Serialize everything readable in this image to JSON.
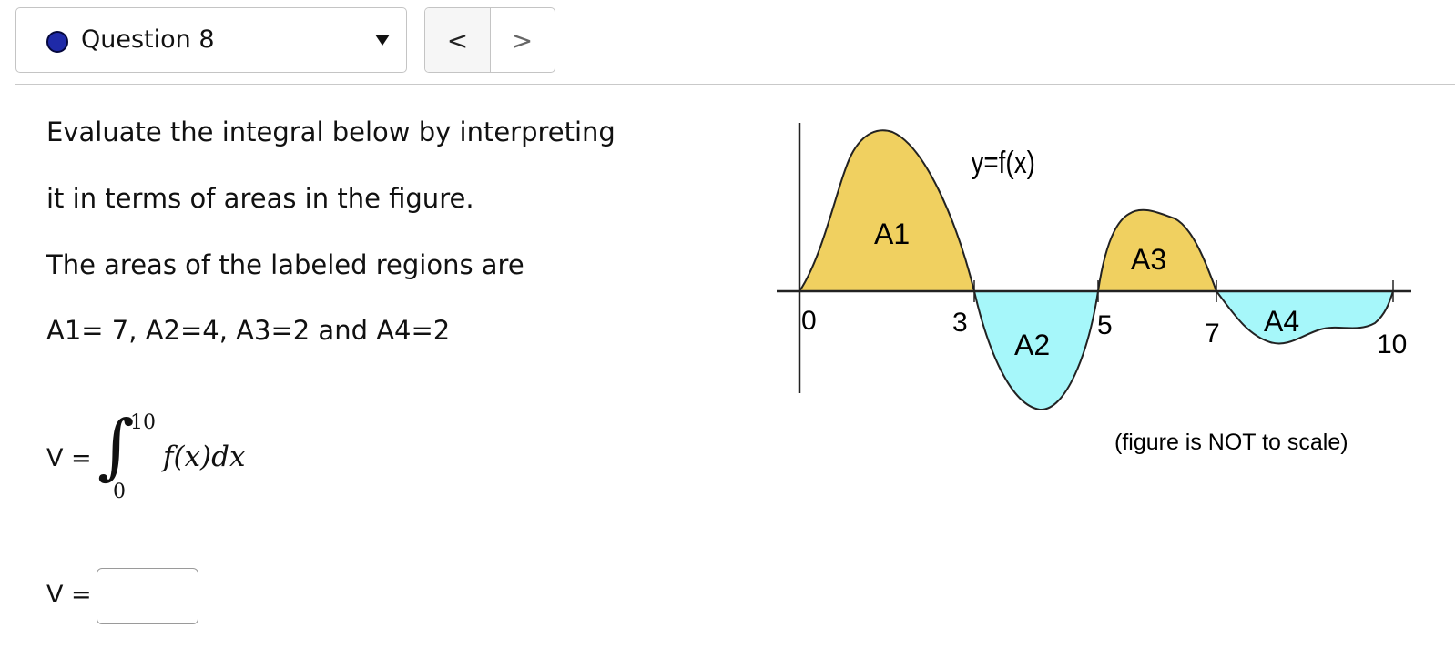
{
  "header": {
    "question_title": "Question 8",
    "prev_label": "<",
    "next_label": ">",
    "status_dot_color": "#1f2aa8"
  },
  "prompt": {
    "line1": "Evaluate the integral below by interpreting",
    "line2": "it in terms of areas in the figure.",
    "line3": "The areas of the labeled regions are",
    "line4": "A1= 7, A2=4, A3=2 and A4=2"
  },
  "integral": {
    "v_label": "V =",
    "upper": "10",
    "lower": "0",
    "integrand": "f(x)dx"
  },
  "answer": {
    "label": "V =",
    "value": "",
    "placeholder": ""
  },
  "figure": {
    "curve_label": "y=f(x)",
    "ticks": [
      "0",
      "3",
      "5",
      "7",
      "10"
    ],
    "regions": [
      "A1",
      "A2",
      "A3",
      "A4"
    ],
    "note": "(figure is NOT to scale)",
    "fill_positive": "#f0d060",
    "fill_negative": "#a6f7fa"
  }
}
